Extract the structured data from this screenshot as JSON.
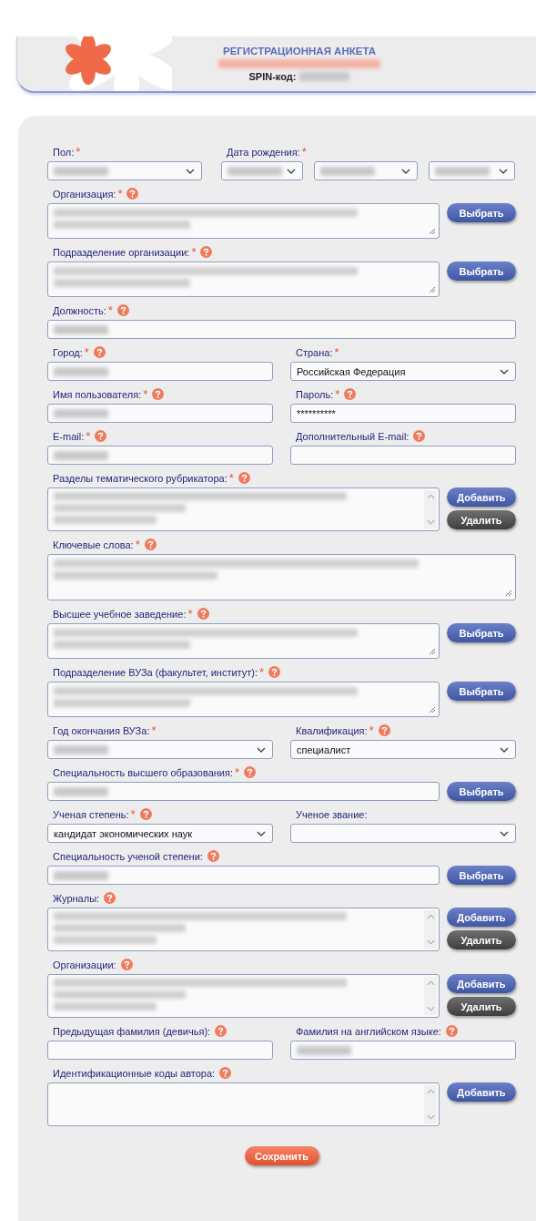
{
  "header": {
    "title": "РЕГИСТРАЦИОННАЯ АНКЕТА",
    "name_redacted": true,
    "spin_label": "SPIN-код:",
    "spin_redacted": true
  },
  "rows": [
    {
      "fields": [
        {
          "label": "Пол:",
          "mark": "*",
          "help": false,
          "kind": "select",
          "redacted": true
        },
        {
          "label": "Дата рождения:",
          "mark": "*",
          "help": false,
          "kind": "date",
          "parts": [
            {
              "redacted": true
            },
            {
              "redacted": true
            },
            {
              "redacted": true
            }
          ]
        }
      ]
    },
    {
      "fields": [
        {
          "label": "Организация:",
          "mark": "*",
          "help": true,
          "kind": "textarea",
          "redacted": true,
          "buttons": [
            {
              "label": "Выбрать",
              "kind": "primary"
            }
          ]
        }
      ]
    },
    {
      "fields": [
        {
          "label": "Подразделение организации:",
          "mark": "*",
          "help": true,
          "kind": "textarea",
          "redacted": true,
          "buttons": [
            {
              "label": "Выбрать",
              "kind": "primary"
            }
          ]
        }
      ]
    },
    {
      "fields": [
        {
          "label": "Должность:",
          "mark": "*",
          "help": true,
          "kind": "input",
          "redacted": true
        }
      ]
    },
    {
      "fields": [
        {
          "label": "Город:",
          "mark": "*",
          "help": true,
          "kind": "input",
          "redacted": true
        },
        {
          "label": "Страна:",
          "mark": "*",
          "help": false,
          "kind": "select",
          "value": "Российская Федерация",
          "redacted": false
        }
      ]
    },
    {
      "fields": [
        {
          "label": "Имя пользователя:",
          "mark": "*",
          "help": true,
          "kind": "input",
          "redacted": true
        },
        {
          "label": "Пароль:",
          "mark": "*",
          "help": true,
          "kind": "input",
          "value": "**********",
          "redacted": false
        }
      ]
    },
    {
      "fields": [
        {
          "label": "E-mail:",
          "mark": "*",
          "help": true,
          "kind": "input",
          "redacted": true
        },
        {
          "label": "Дополнительный E-mail:",
          "help": true,
          "kind": "input",
          "redacted": false
        }
      ]
    },
    {
      "fields": [
        {
          "label": "Разделы тематического рубрикатора:",
          "mark": "*",
          "help": true,
          "kind": "list",
          "redacted": true,
          "buttons": [
            {
              "label": "Добавить",
              "kind": "primary"
            },
            {
              "label": "Удалить",
              "kind": "secondary"
            }
          ]
        }
      ]
    },
    {
      "fields": [
        {
          "label": "Ключевые слова:",
          "mark": "*",
          "help": true,
          "kind": "bigtext",
          "redacted": true
        }
      ]
    },
    {
      "fields": [
        {
          "label": "Высшее учебное заведение:",
          "mark": "*",
          "help": true,
          "kind": "textarea",
          "redacted": true,
          "buttons": [
            {
              "label": "Выбрать",
              "kind": "primary"
            }
          ]
        }
      ]
    },
    {
      "fields": [
        {
          "label": "Подразделение ВУЗа (факультет, институт):",
          "mark": "*",
          "help": true,
          "kind": "textarea",
          "redacted": true,
          "buttons": [
            {
              "label": "Выбрать",
              "kind": "primary"
            }
          ]
        }
      ]
    },
    {
      "fields": [
        {
          "label": "Год окончания ВУЗа:",
          "mark": "*",
          "help": false,
          "kind": "select",
          "redacted": true
        },
        {
          "label": "Квалификация:",
          "mark": "*",
          "help": true,
          "kind": "select",
          "value": "специалист",
          "redacted": false
        }
      ]
    },
    {
      "fields": [
        {
          "label": "Специальность высшего образования:",
          "mark": "*",
          "help": true,
          "kind": "input",
          "redacted": true,
          "buttons": [
            {
              "label": "Выбрать",
              "kind": "primary"
            }
          ]
        }
      ]
    },
    {
      "fields": [
        {
          "label": "Ученая степень:",
          "mark": "*",
          "help": true,
          "kind": "select",
          "value": "кандидат экономических наук",
          "redacted": false
        },
        {
          "label": "Ученое звание:",
          "help": false,
          "kind": "select",
          "redacted": false
        }
      ]
    },
    {
      "fields": [
        {
          "label": "Специальность ученой степени:",
          "help": true,
          "kind": "input",
          "redacted": true,
          "buttons": [
            {
              "label": "Выбрать",
              "kind": "primary"
            }
          ]
        }
      ]
    },
    {
      "fields": [
        {
          "label": "Журналы:",
          "help": true,
          "kind": "list",
          "redacted": true,
          "buttons": [
            {
              "label": "Добавить",
              "kind": "primary"
            },
            {
              "label": "Удалить",
              "kind": "secondary"
            }
          ]
        }
      ]
    },
    {
      "fields": [
        {
          "label": "Организации:",
          "help": true,
          "kind": "list",
          "redacted": true,
          "buttons": [
            {
              "label": "Добавить",
              "kind": "primary"
            },
            {
              "label": "Удалить",
              "kind": "secondary"
            }
          ]
        }
      ]
    },
    {
      "fields": [
        {
          "label": "Предыдущая фамилия (девичья):",
          "help": true,
          "kind": "input",
          "redacted": false
        },
        {
          "label": "Фамилия на английском языке:",
          "help": true,
          "kind": "input",
          "redacted": true
        }
      ]
    },
    {
      "fields": [
        {
          "label": "Идентификационные коды автора:",
          "help": true,
          "kind": "list",
          "redacted": false,
          "buttons": [
            {
              "label": "Добавить",
              "kind": "primary"
            }
          ]
        }
      ]
    }
  ],
  "save_button": "Сохранить"
}
